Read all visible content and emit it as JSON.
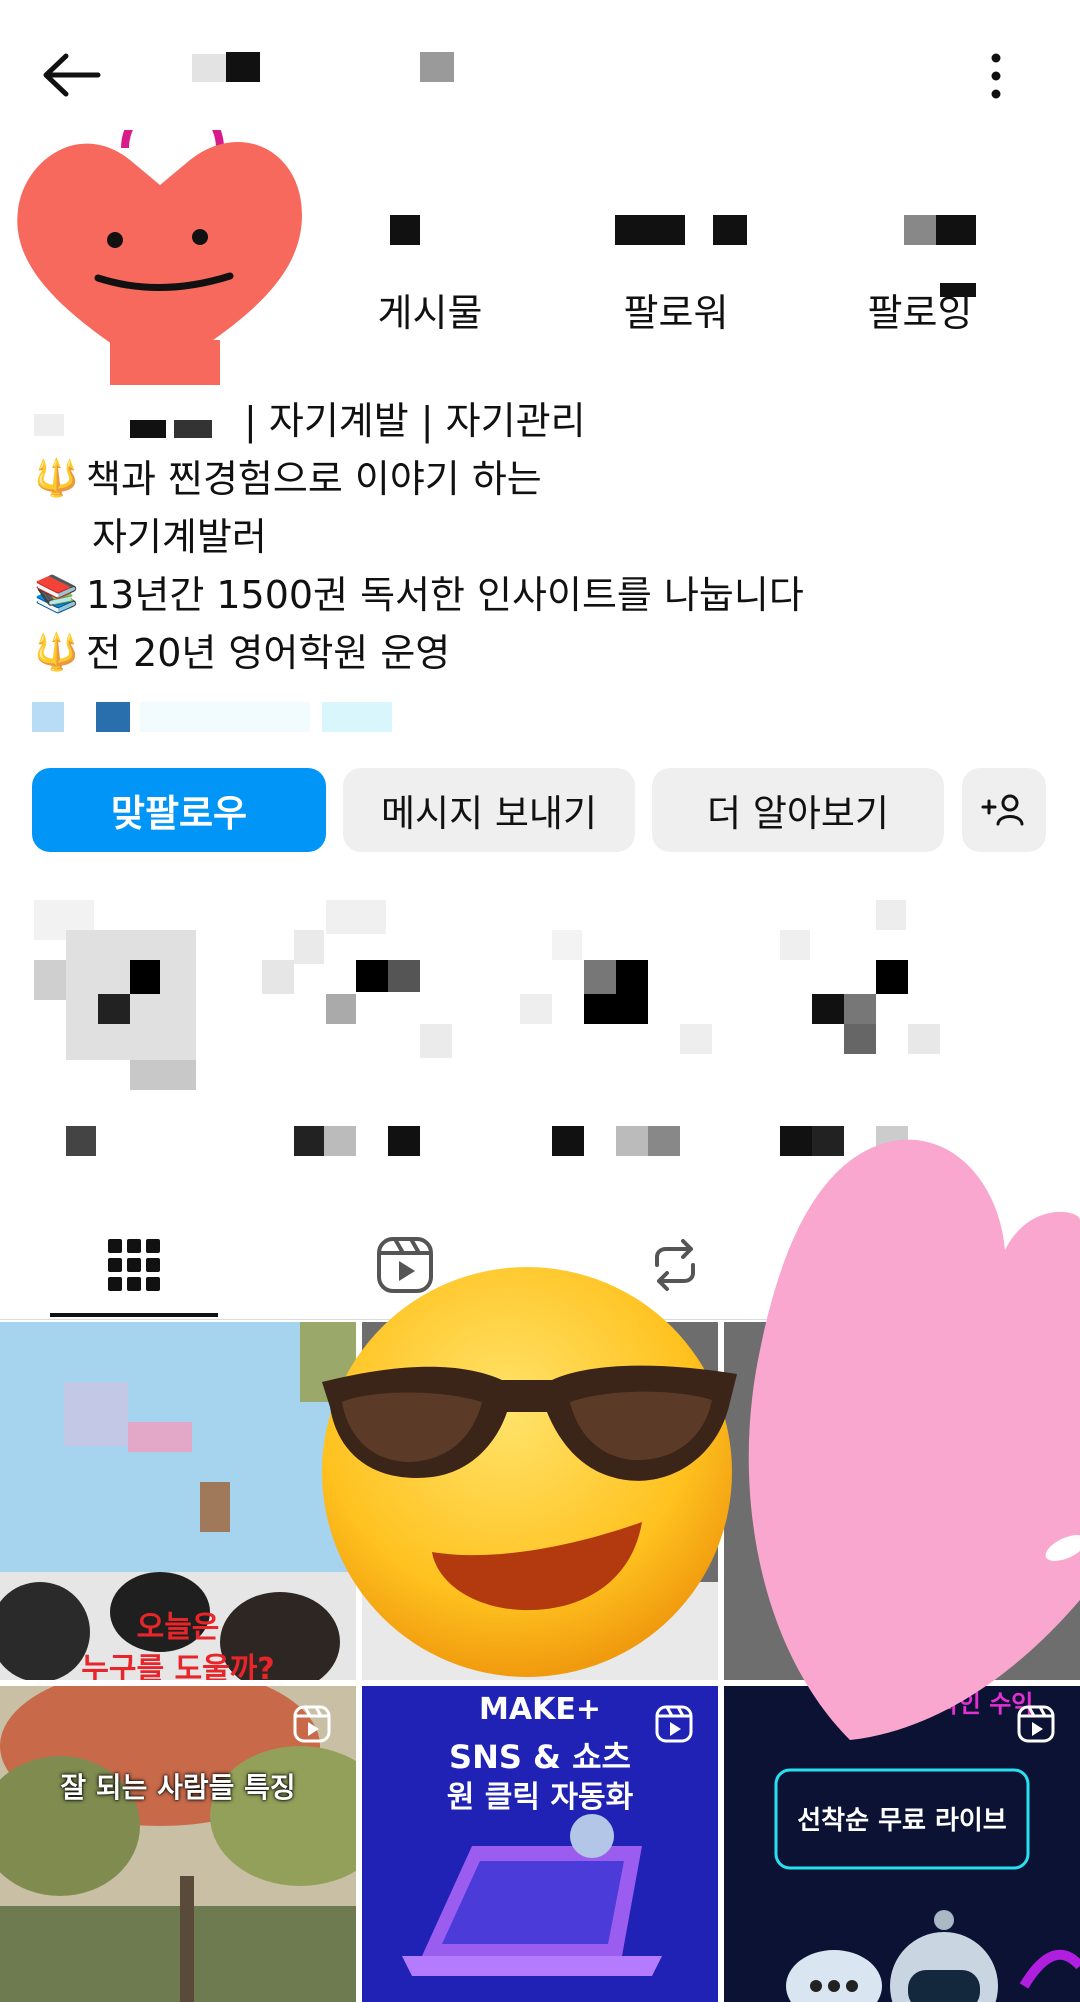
{
  "header": {
    "back_icon": "arrow-left-icon",
    "more_icon": "more-vertical-icon"
  },
  "stats": {
    "posts_label": "게시물",
    "followers_label": "팔로워",
    "following_label": "팔로잉"
  },
  "bio": {
    "line1": "| 자기계발 | 자기관리",
    "line2_icon": "🔱",
    "line2": "책과 찐경험으로 이야기 하는",
    "line3": "자기계발러",
    "line4_icon": "📚",
    "line4": "13년간 1500권 독서한 인사이트를 나눕니다",
    "line5_icon": "🔱",
    "line5": "전 20년 영어학원 운영"
  },
  "actions": {
    "follow_back": "맞팔로우",
    "message": "메시지 보내기",
    "learn_more": "더 알아보기",
    "add_person_icon": "add-person-icon"
  },
  "tabs": [
    {
      "icon": "grid-icon",
      "active": true
    },
    {
      "icon": "reels-icon",
      "active": false
    },
    {
      "icon": "reposts-icon",
      "active": false
    }
  ],
  "posts": {
    "post1_text_a": "오늘은",
    "post1_text_b": "누구를 도울까?",
    "post4_text": "잘 되는 사람들 특징",
    "post5_text_a": "MAKE+",
    "post5_text_b": "SNS & 쇼츠",
    "post5_text_c": "원 클릭 자동화",
    "post6_text_a": "온라인 수익",
    "post6_text_b": "선착순 무료 라이브"
  },
  "colors": {
    "accent": "#0095f6",
    "button_gray": "#efefef",
    "heart_red": "#f7695d",
    "heart_pink": "#f9a7cf"
  }
}
